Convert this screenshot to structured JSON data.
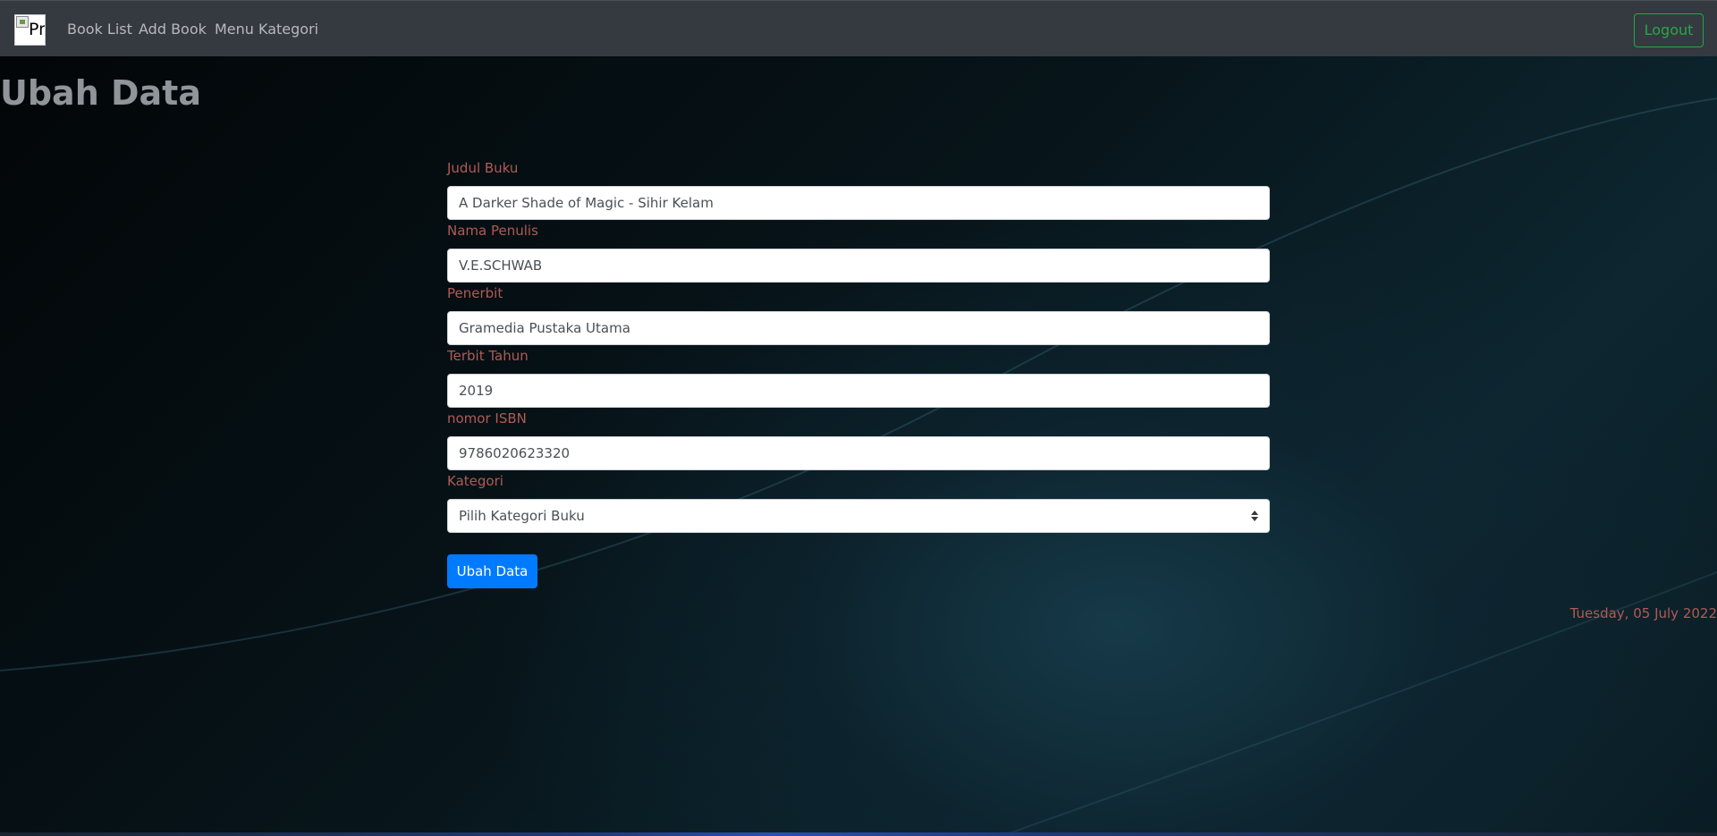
{
  "navbar": {
    "brand_alt": "Pr",
    "links": [
      {
        "label": "Book List"
      },
      {
        "label": "Add Book"
      },
      {
        "label": "Menu Kategori"
      }
    ],
    "logout_label": "Logout"
  },
  "page": {
    "title": "Ubah Data"
  },
  "form": {
    "fields": [
      {
        "label": "Judul Buku",
        "value": "A Darker Shade of Magic - Sihir Kelam"
      },
      {
        "label": "Nama Penulis",
        "value": "V.E.SCHWAB"
      },
      {
        "label": "Penerbit",
        "value": "Gramedia Pustaka Utama"
      },
      {
        "label": "Terbit Tahun",
        "value": "2019"
      },
      {
        "label": "nomor ISBN",
        "value": "9786020623320"
      }
    ],
    "category": {
      "label": "Kategori",
      "selected": "Pilih Kategori Buku"
    },
    "submit_label": "Ubah Data"
  },
  "footer": {
    "date": "Tuesday, 05 July 2022"
  },
  "colors": {
    "navbar_bg": "#343a40",
    "label": "#b25a55",
    "primary": "#007bff",
    "success": "#28a745"
  }
}
